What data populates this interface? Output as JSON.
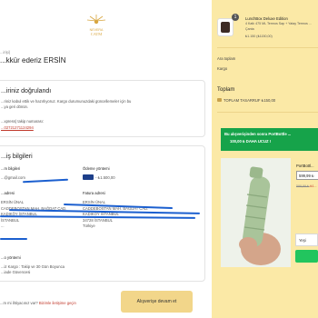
{
  "brand": {
    "logo_text": "NEVERA\nCATM",
    "accent": "#d8a640"
  },
  "header": {
    "breadcrumb": "...irişi(",
    "title": "...kkür ederiz ERSİN"
  },
  "confirm_card": {
    "title": "...iriniz doğrulandı",
    "body_line1": "...riniz kabul ettik ve hazırlıyoruz. Kargo durumunuzdaki güncellemeler için bu",
    "body_line2": "...ya geri dönün.",
    "tracking_label": "...xpress) takip numarası:",
    "tracking_number": "...02721271124294"
  },
  "details_card": {
    "title": "...iş bilgileri",
    "contact_label": "...m bilgileri",
    "contact_value": "...@gmail.com",
    "payment_label": "Ödeme yöntemi",
    "payment_value": "- ₺1.500,00",
    "shipping_label": "...adresi",
    "billing_label": "Fatura adresi",
    "shipping_lines": [
      "ERSİN ÜNAL",
      "CADDEBOSTAN MAH. BAĞDAT CAD.",
      "KADIKÖY İSTANBUL",
      "İSTANBUL",
      "..."
    ],
    "billing_lines": [
      "ERSİN ÜNAL",
      "CADDEBOSTAN MAH. BAĞDAT CAD.",
      "KADIKÖY İSTANBUL",
      "34728 İSTANBUL",
      "Türkiye"
    ],
    "shipping_method_label": "...o yöntemi",
    "shipping_method_value": "...iz Kargo : Takip ve 30 Gün Boyunca",
    "shipping_method_value2": "...iade Güvencesi"
  },
  "footer": {
    "help_text": "...m mi ihtiyacınız var?",
    "help_link": "Bizimle iletişime geçin",
    "continue_button": "Alışverişe devam et"
  },
  "order_summary": {
    "qty_badge": "1",
    "product_name": "LunchBox Deluxe Edition",
    "product_variant": "4 Katlı 475 ML Termos Sap + Yatay Termos ...",
    "product_variant2": "Çanta",
    "product_price": "₺1.150 (₺1150,00)",
    "subtotal_label": "Ara toplam",
    "shipping_label": "Kargo",
    "total_label": "Toplam",
    "savings_label": "TOPLAM TASARRUF ₺150,00",
    "upsell_banner_line1": "Bu alışverişinden sonra PortBottle ...",
    "upsell_banner_line2": "100,00 ₺ DAHA UCUZ !",
    "upsell_product_name": "PortBottl...",
    "upsell_price": "599,99 ₺",
    "upsell_old_price": "599,99 ₺",
    "upsell_discount": "-₺1...",
    "upsell_select": "Yeşi"
  }
}
